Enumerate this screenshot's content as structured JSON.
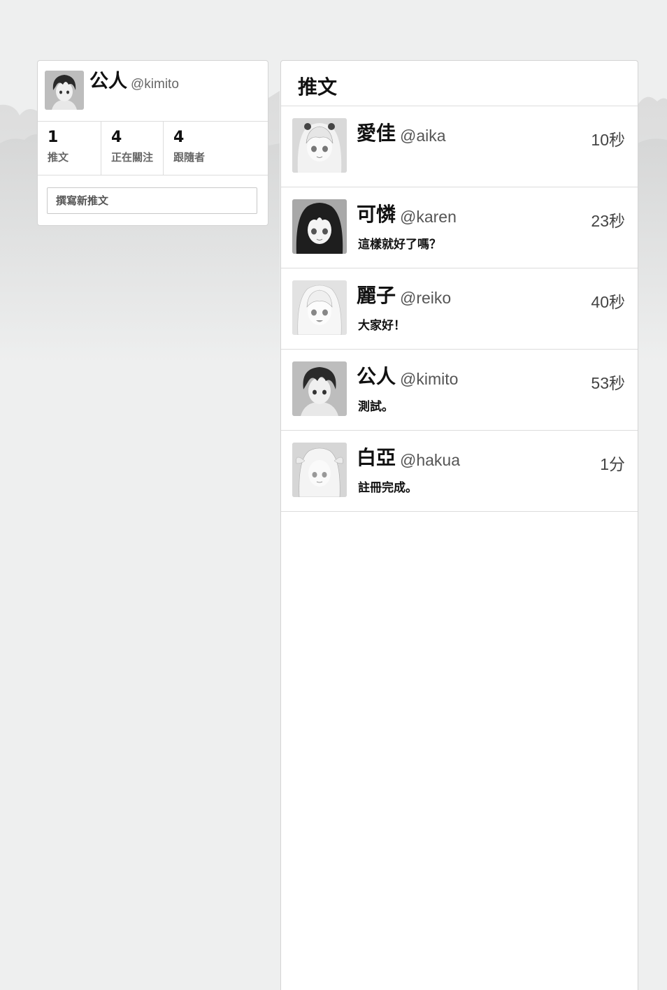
{
  "profile": {
    "name": "公人",
    "handle": "@kimito",
    "stats": [
      {
        "value": "1",
        "label": "推文"
      },
      {
        "value": "4",
        "label": "正在關注"
      },
      {
        "value": "4",
        "label": "跟隨者"
      }
    ],
    "compose_placeholder": "撰寫新推文"
  },
  "timeline": {
    "title": "推文",
    "tweets": [
      {
        "name": "愛佳",
        "handle": "@aika",
        "time": "10秒",
        "text": ""
      },
      {
        "name": "可憐",
        "handle": "@karen",
        "time": "23秒",
        "text": "這樣就好了嗎？"
      },
      {
        "name": "麗子",
        "handle": "@reiko",
        "time": "40秒",
        "text": "大家好！"
      },
      {
        "name": "公人",
        "handle": "@kimito",
        "time": "53秒",
        "text": "測試。"
      },
      {
        "name": "白亞",
        "handle": "@hakua",
        "time": "1分",
        "text": "註冊完成。"
      }
    ]
  },
  "colors": {
    "background": "#eeefef",
    "card": "#ffffff",
    "border": "#dcdcdc",
    "text": "#111111",
    "muted": "#666666"
  }
}
